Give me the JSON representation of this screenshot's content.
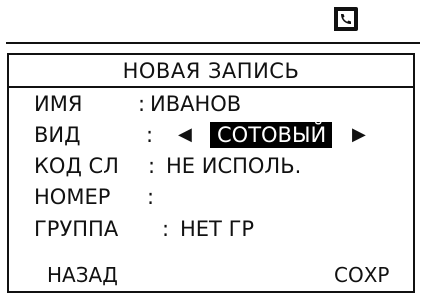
{
  "status_bar": {
    "icon": "phone-book-icon"
  },
  "screen": {
    "title": "НОВАЯ ЗАПИСЬ",
    "fields": [
      {
        "label": "ИМЯ",
        "separator": ":",
        "value": "ИВАНОВ"
      },
      {
        "label": "ВИД",
        "separator": ":",
        "value": "СОТОВЫЙ",
        "left_arrow": "◀",
        "right_arrow": "▶"
      },
      {
        "label": "КОД СЛ",
        "separator": ":",
        "value": "НЕ ИСПОЛЬ."
      },
      {
        "label": "НОМЕР",
        "separator": ":",
        "value": ""
      },
      {
        "label": "ГРУППА",
        "separator": ":",
        "value": "НЕТ ГР"
      }
    ],
    "softkeys": {
      "left": "НАЗАД",
      "right": "СОХР"
    }
  }
}
